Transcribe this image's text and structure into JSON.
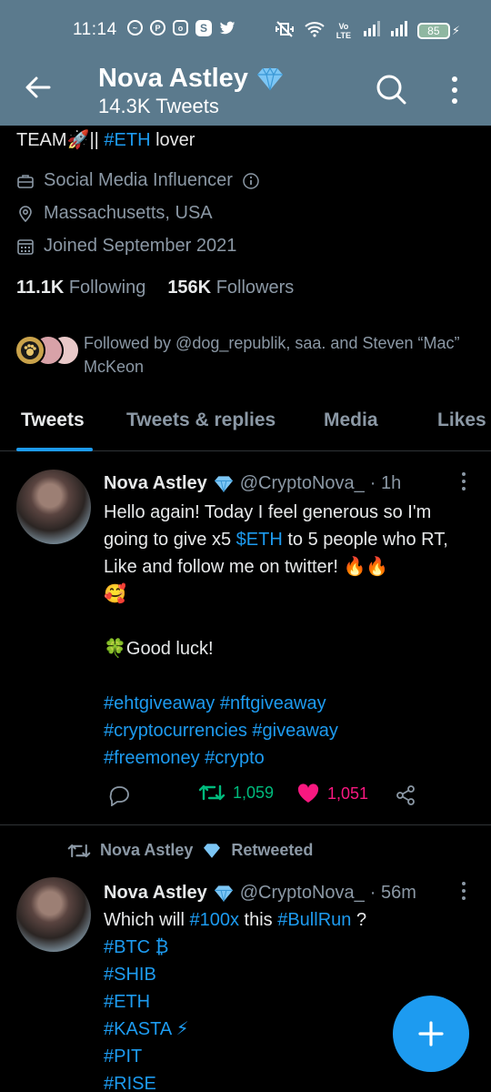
{
  "status_bar": {
    "time": "11:14",
    "notification_icons": [
      "messenger-icon",
      "pinterest-icon",
      "instagram-icon",
      "s-app-icon",
      "twitter-icon"
    ],
    "network_label": "Vo LTE",
    "battery": "85"
  },
  "header": {
    "name": "Nova Astley",
    "tweet_count": "14.3K Tweets"
  },
  "profile": {
    "bio_prefix": "TEAM🚀||",
    "bio_tag": "#ETH",
    "bio_suffix": "lover",
    "category": "Social Media Influencer",
    "location": "Massachusetts, USA",
    "joined": "Joined September 2021",
    "following_count": "11.1K",
    "following_label": "Following",
    "followers_count": "156K",
    "followers_label": "Followers",
    "followed_by": "Followed by @dog_republik, saa. and Steven “Mac” McKeon"
  },
  "tabs": [
    "Tweets",
    "Tweets & replies",
    "Media",
    "Likes"
  ],
  "tweet1": {
    "name": "Nova Astley",
    "handle": "@CryptoNova_",
    "time": "· 1h",
    "line1a": "Hello again! Today I feel generous so I'm going to give x5",
    "line1b": "$ETH",
    "line1c": "to 5 people who RT, Like and follow me on twitter! 🔥🔥",
    "emoji_line": "🥰",
    "good_luck": "🍀Good luck!",
    "hashtags1": "#ehtgiveaway #nftgiveaway",
    "hashtags2": "#cryptocurrencies #giveaway",
    "hashtags3": "#freemoney #crypto",
    "retweets": "1,059",
    "likes": "1,051"
  },
  "retweet_label": {
    "name": "Nova Astley",
    "suffix": "Retweeted"
  },
  "tweet2": {
    "name": "Nova Astley",
    "handle": "@CryptoNova_",
    "time": "· 56m",
    "text_a": "Which will",
    "tag_a": "#100x",
    "text_b": "this",
    "tag_b": "#BullRun",
    "text_c": "?",
    "tags": [
      "#BTC ₿",
      "#SHIB",
      "#ETH",
      "#KASTA ⚡",
      "#PIT",
      "#RISE"
    ]
  },
  "colors": {
    "header_bg": "#5b7a8d",
    "accent": "#1d9bf0",
    "retweet_green": "#00ba7c",
    "like_pink": "#f91880",
    "muted": "#8b98a5"
  }
}
